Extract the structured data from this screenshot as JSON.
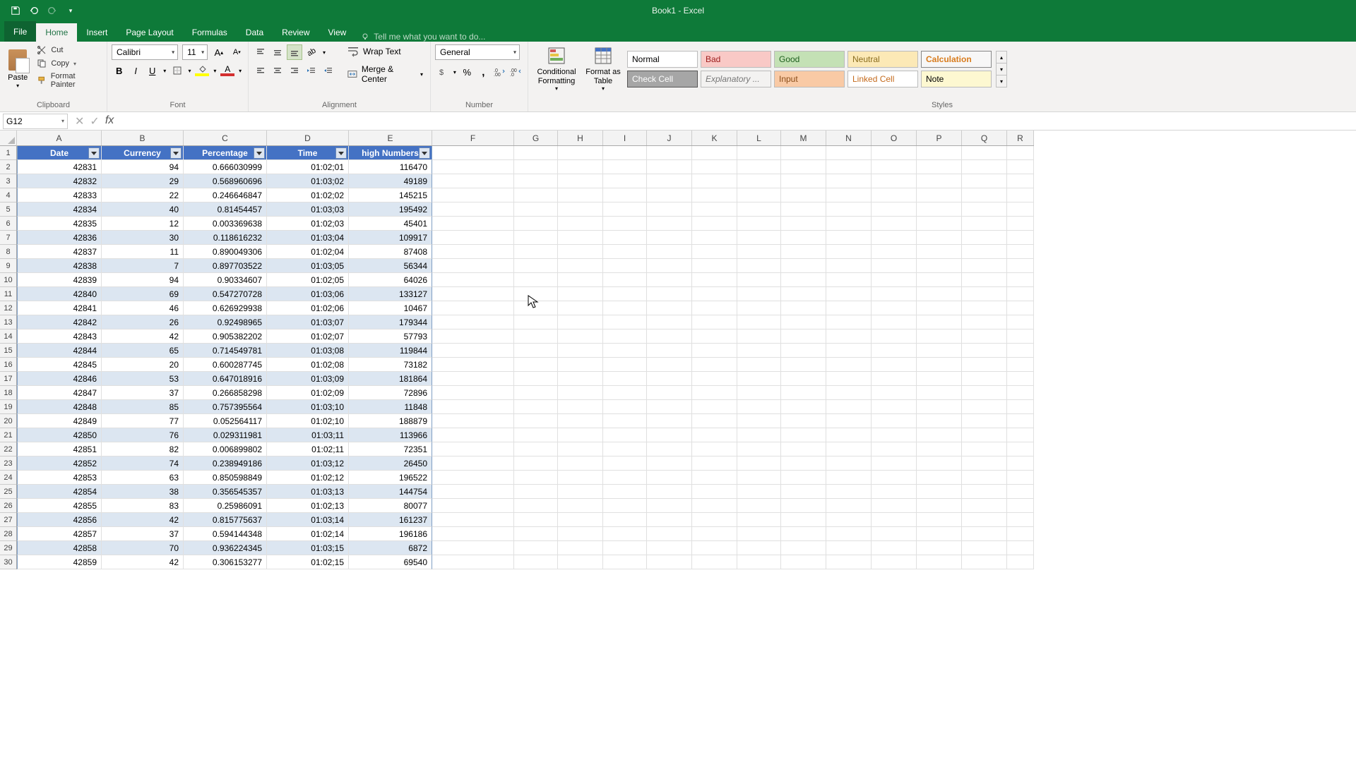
{
  "title": "Book1 - Excel",
  "qat": {
    "save": "save-icon",
    "undo": "undo-icon",
    "redo": "redo-icon"
  },
  "tabs": [
    "File",
    "Home",
    "Insert",
    "Page Layout",
    "Formulas",
    "Data",
    "Review",
    "View"
  ],
  "active_tab": "Home",
  "tellme": "Tell me what you want to do...",
  "ribbon": {
    "clipboard": {
      "label": "Clipboard",
      "paste": "Paste",
      "cut": "Cut",
      "copy": "Copy",
      "fp": "Format Painter"
    },
    "font": {
      "label": "Font",
      "name": "Calibri",
      "size": "11",
      "bold": "B",
      "italic": "I",
      "underline": "U"
    },
    "alignment": {
      "label": "Alignment",
      "wrap": "Wrap Text",
      "merge": "Merge & Center"
    },
    "number": {
      "label": "Number",
      "format": "General"
    },
    "styles": {
      "label": "Styles",
      "cf": "Conditional\nFormatting",
      "ft": "Format as\nTable",
      "s0": "Normal",
      "s1": "Bad",
      "s2": "Good",
      "s3": "Neutral",
      "s4": "Calculation",
      "s5": "Check Cell",
      "s6": "Explanatory ...",
      "s7": "Input",
      "s8": "Linked Cell",
      "s9": "Note"
    }
  },
  "namebox": "G12",
  "columns": [
    "A",
    "B",
    "C",
    "D",
    "E",
    "F",
    "G",
    "H",
    "I",
    "J",
    "K",
    "L",
    "M",
    "N",
    "O",
    "P",
    "Q",
    "R"
  ],
  "table": {
    "headers": [
      "Date",
      "Currency",
      "Percentage",
      "Time",
      "high Numbers"
    ],
    "rows": [
      [
        "42831",
        "94",
        "0.666030999",
        "01:02;01",
        "116470"
      ],
      [
        "42832",
        "29",
        "0.568960696",
        "01:03;02",
        "49189"
      ],
      [
        "42833",
        "22",
        "0.246646847",
        "01:02;02",
        "145215"
      ],
      [
        "42834",
        "40",
        "0.81454457",
        "01:03;03",
        "195492"
      ],
      [
        "42835",
        "12",
        "0.003369638",
        "01:02;03",
        "45401"
      ],
      [
        "42836",
        "30",
        "0.118616232",
        "01:03;04",
        "109917"
      ],
      [
        "42837",
        "11",
        "0.890049306",
        "01:02;04",
        "87408"
      ],
      [
        "42838",
        "7",
        "0.897703522",
        "01:03;05",
        "56344"
      ],
      [
        "42839",
        "94",
        "0.90334607",
        "01:02;05",
        "64026"
      ],
      [
        "42840",
        "69",
        "0.547270728",
        "01:03;06",
        "133127"
      ],
      [
        "42841",
        "46",
        "0.626929938",
        "01:02;06",
        "10467"
      ],
      [
        "42842",
        "26",
        "0.92498965",
        "01:03;07",
        "179344"
      ],
      [
        "42843",
        "42",
        "0.905382202",
        "01:02;07",
        "57793"
      ],
      [
        "42844",
        "65",
        "0.714549781",
        "01:03;08",
        "119844"
      ],
      [
        "42845",
        "20",
        "0.600287745",
        "01:02;08",
        "73182"
      ],
      [
        "42846",
        "53",
        "0.647018916",
        "01:03;09",
        "181864"
      ],
      [
        "42847",
        "37",
        "0.266858298",
        "01:02;09",
        "72896"
      ],
      [
        "42848",
        "85",
        "0.757395564",
        "01:03;10",
        "11848"
      ],
      [
        "42849",
        "77",
        "0.052564117",
        "01:02;10",
        "188879"
      ],
      [
        "42850",
        "76",
        "0.029311981",
        "01:03;11",
        "113966"
      ],
      [
        "42851",
        "82",
        "0.006899802",
        "01:02;11",
        "72351"
      ],
      [
        "42852",
        "74",
        "0.238949186",
        "01:03;12",
        "26450"
      ],
      [
        "42853",
        "63",
        "0.850598849",
        "01:02;12",
        "196522"
      ],
      [
        "42854",
        "38",
        "0.356545357",
        "01:03;13",
        "144754"
      ],
      [
        "42855",
        "83",
        "0.25986091",
        "01:02;13",
        "80077"
      ],
      [
        "42856",
        "42",
        "0.815775637",
        "01:03;14",
        "161237"
      ],
      [
        "42857",
        "37",
        "0.594144348",
        "01:02;14",
        "196186"
      ],
      [
        "42858",
        "70",
        "0.936224345",
        "01:03;15",
        "6872"
      ],
      [
        "42859",
        "42",
        "0.306153277",
        "01:02;15",
        "69540"
      ]
    ]
  }
}
